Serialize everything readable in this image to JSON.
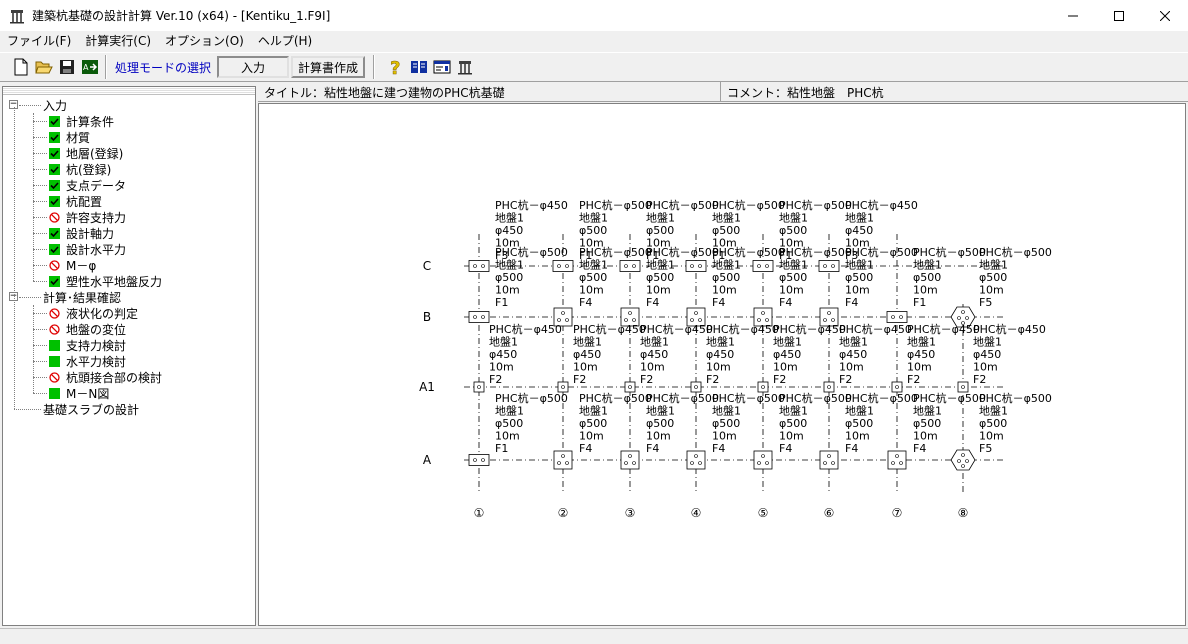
{
  "window": {
    "title": "建築杭基礎の設計計算 Ver.10 (x64) - [Kentiku_1.F9I]"
  },
  "menu": [
    "ファイル(F)",
    "計算実行(C)",
    "オプション(O)",
    "ヘルプ(H)"
  ],
  "toolbar": {
    "mode_label": "処理モードの選択",
    "mode_input": "入力",
    "mode_report": "計算書作成",
    "buttons": [
      "new-file-icon",
      "open-folder-icon",
      "save-disk-icon",
      "export-icon",
      "help-icon",
      "book-icon",
      "card-icon",
      "building-icon"
    ]
  },
  "info": {
    "title": "タイトル：粘性地盤に建つ建物のPHC杭基礎",
    "comment": "コメント：粘性地盤　PHC杭"
  },
  "tree": {
    "groups": [
      {
        "label": "入力",
        "items": [
          {
            "label": "計算条件",
            "status": "ok"
          },
          {
            "label": "材質",
            "status": "ok"
          },
          {
            "label": "地層(登録)",
            "status": "ok"
          },
          {
            "label": "杭(登録)",
            "status": "ok"
          },
          {
            "label": "支点データ",
            "status": "ok"
          },
          {
            "label": "杭配置",
            "status": "ok"
          },
          {
            "label": "許容支持力",
            "status": "ng"
          },
          {
            "label": "設計軸力",
            "status": "ok"
          },
          {
            "label": "設計水平力",
            "status": "ok"
          },
          {
            "label": "M－φ",
            "status": "ng"
          },
          {
            "label": "塑性水平地盤反力",
            "status": "ok"
          }
        ]
      },
      {
        "label": "計算･結果確認",
        "items": [
          {
            "label": "液状化の判定",
            "status": "ng"
          },
          {
            "label": "地盤の変位",
            "status": "ng"
          },
          {
            "label": "支持力検討",
            "status": "green"
          },
          {
            "label": "水平力検討",
            "status": "green"
          },
          {
            "label": "杭頭接合部の検討",
            "status": "ng"
          },
          {
            "label": "M－N図",
            "status": "green"
          }
        ]
      },
      {
        "label": "基礎スラブの設計",
        "items": []
      }
    ]
  },
  "plan": {
    "rows": [
      "C",
      "B",
      "A1",
      "A"
    ],
    "columns": [
      "①",
      "②",
      "③",
      "④",
      "⑤",
      "⑥",
      "⑦",
      "⑧"
    ],
    "labels": {
      "C": [
        [
          "PHC杭－φ450",
          "地盤1",
          "φ450",
          "10m",
          "F3"
        ],
        [
          "PHC杭－φ500",
          "地盤1",
          "φ500",
          "10m",
          "F1"
        ],
        [
          "PHC杭－φ500",
          "地盤1",
          "φ500",
          "10m",
          "F1"
        ],
        [
          "PHC杭－φ500",
          "地盤1",
          "φ500",
          "10m",
          "F1"
        ],
        [
          "PHC杭－φ500",
          "地盤1",
          "φ500",
          "10m",
          "F1"
        ],
        [
          "PHC杭－φ450",
          "地盤1",
          "φ450",
          "10m",
          "F3"
        ]
      ],
      "B": [
        [
          "PHC杭－φ500",
          "地盤1",
          "φ500",
          "10m",
          "F1"
        ],
        [
          "PHC杭－φ500",
          "地盤1",
          "φ500",
          "10m",
          "F4"
        ],
        [
          "PHC杭－φ500",
          "地盤1",
          "φ500",
          "10m",
          "F4"
        ],
        [
          "PHC杭－φ500",
          "地盤1",
          "φ500",
          "10m",
          "F4"
        ],
        [
          "PHC杭－φ500",
          "地盤1",
          "φ500",
          "10m",
          "F4"
        ],
        [
          "PHC杭－φ500",
          "地盤1",
          "φ500",
          "10m",
          "F4"
        ],
        [
          "PHC杭－φ500",
          "地盤1",
          "φ500",
          "10m",
          "F1"
        ],
        [
          "PHC杭－φ500",
          "地盤1",
          "φ500",
          "10m",
          "F5"
        ]
      ],
      "A1": [
        [
          "PHC杭－φ450",
          "地盤1",
          "φ450",
          "10m",
          "F2"
        ],
        [
          "PHC杭－φ450",
          "地盤1",
          "φ450",
          "10m",
          "F2"
        ],
        [
          "PHC杭－φ450",
          "地盤1",
          "φ450",
          "10m",
          "F2"
        ],
        [
          "PHC杭－φ450",
          "地盤1",
          "φ450",
          "10m",
          "F2"
        ],
        [
          "PHC杭－φ450",
          "地盤1",
          "φ450",
          "10m",
          "F2"
        ],
        [
          "PHC杭－φ450",
          "地盤1",
          "φ450",
          "10m",
          "F2"
        ],
        [
          "PHC杭－φ450",
          "地盤1",
          "φ450",
          "10m",
          "F2"
        ],
        [
          "PHC杭－φ450",
          "地盤1",
          "φ450",
          "10m",
          "F2"
        ]
      ],
      "A": [
        [
          "PHC杭－φ500",
          "地盤1",
          "φ500",
          "10m",
          "F1"
        ],
        [
          "PHC杭－φ500",
          "地盤1",
          "φ500",
          "10m",
          "F4"
        ],
        [
          "PHC杭－φ500",
          "地盤1",
          "φ500",
          "10m",
          "F4"
        ],
        [
          "PHC杭－φ500",
          "地盤1",
          "φ500",
          "10m",
          "F4"
        ],
        [
          "PHC杭－φ500",
          "地盤1",
          "φ500",
          "10m",
          "F4"
        ],
        [
          "PHC杭－φ500",
          "地盤1",
          "φ500",
          "10m",
          "F4"
        ],
        [
          "PHC杭－φ500",
          "地盤1",
          "φ500",
          "10m",
          "F4"
        ],
        [
          "PHC杭－φ500",
          "地盤1",
          "φ500",
          "10m",
          "F5"
        ]
      ]
    },
    "c_columns": [
      0,
      1,
      2,
      3,
      4,
      5
    ]
  },
  "colors": {
    "check_green": "#00c000",
    "ng_red": "#e00000",
    "mode_blue": "#0000c0"
  }
}
